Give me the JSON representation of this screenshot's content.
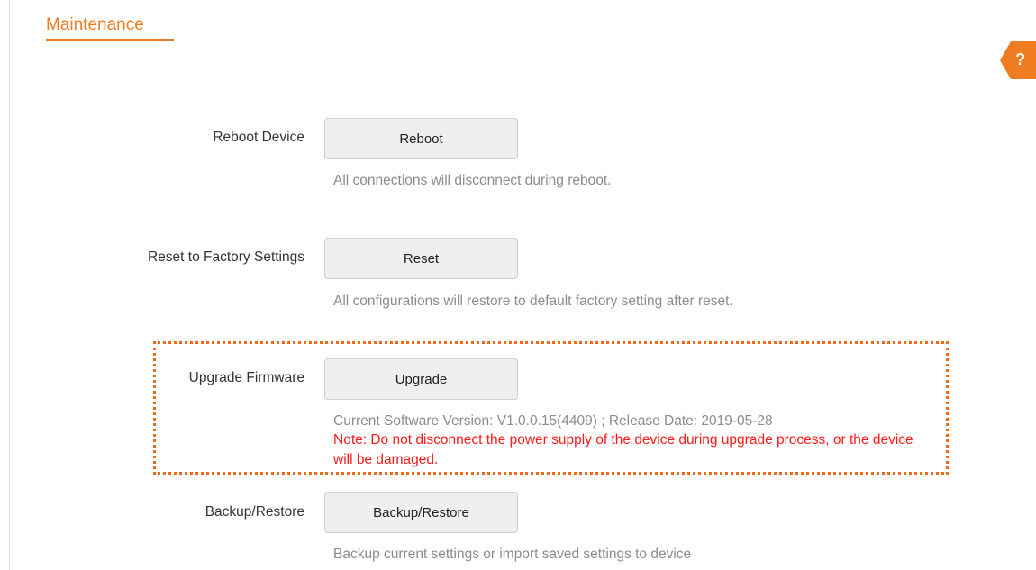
{
  "header": {
    "title": "Maintenance",
    "help_icon_glyph": "?",
    "accent_color": "#f07c22"
  },
  "rows": {
    "reboot": {
      "label": "Reboot Device",
      "button_label": "Reboot",
      "description": "All connections will disconnect during reboot."
    },
    "reset": {
      "label": "Reset to Factory Settings",
      "button_label": "Reset",
      "description": "All configurations will restore to default factory setting after reset."
    },
    "upgrade": {
      "label": "Upgrade Firmware",
      "button_label": "Upgrade",
      "description": "Current Software Version: V1.0.0.15(4409) ; Release Date: 2019-05-28",
      "note": "Note: Do not disconnect the power supply of the device during upgrade process, or the device will be damaged.",
      "note_color": "#ff1a1a"
    },
    "backup": {
      "label": "Backup/Restore",
      "button_label": "Backup/Restore",
      "description": "Backup current settings or import saved settings to device"
    }
  },
  "annotation": {
    "highlight_color": "#ee6a1a"
  }
}
